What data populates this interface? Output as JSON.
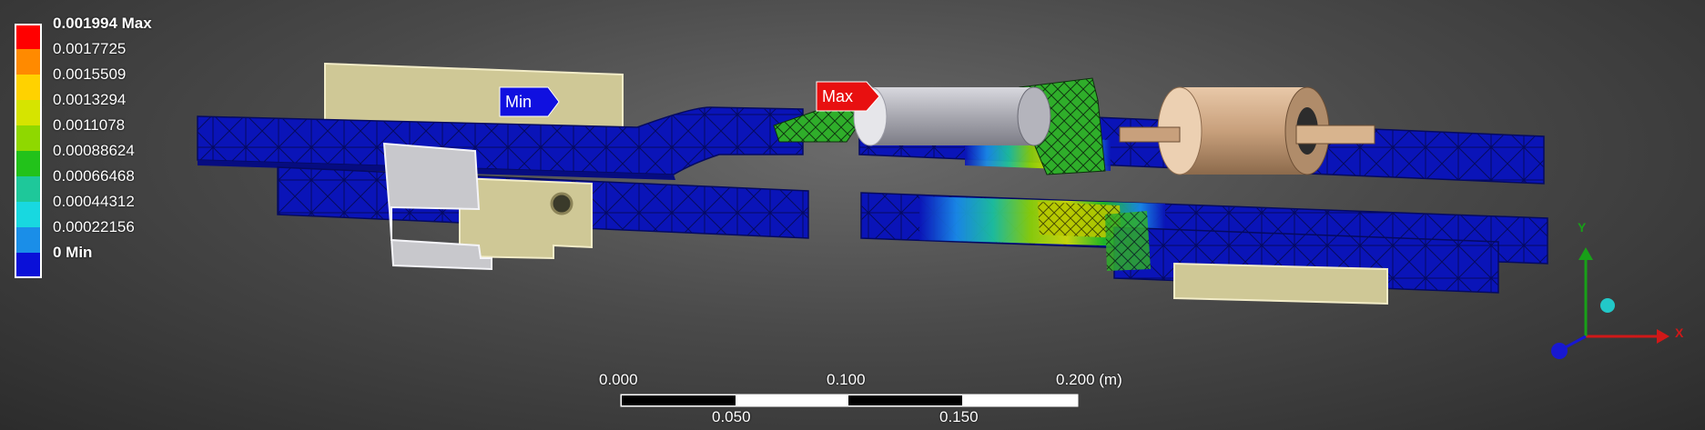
{
  "legend": {
    "entries": [
      {
        "label": "0.001994 Max",
        "color": "#ff0000",
        "bold": true
      },
      {
        "label": "0.0017725",
        "color": "#ff8a00"
      },
      {
        "label": "0.0015509",
        "color": "#ffd200"
      },
      {
        "label": "0.0013294",
        "color": "#d6e400"
      },
      {
        "label": "0.0011078",
        "color": "#8fd800"
      },
      {
        "label": "0.00088624",
        "color": "#22c21a"
      },
      {
        "label": "0.00066468",
        "color": "#1ec89a"
      },
      {
        "label": "0.00044312",
        "color": "#18d8e0"
      },
      {
        "label": "0.00022156",
        "color": "#1a8ee8"
      },
      {
        "label": "0 Min",
        "color": "#0a10d8",
        "bold": true
      }
    ]
  },
  "probes": {
    "min_label": "Min",
    "max_label": "Max",
    "min_color": "#1010e0",
    "max_color": "#e81010"
  },
  "scale_bar": {
    "top_labels": [
      "0.000",
      "0.100",
      "0.200 (m)"
    ],
    "bottom_labels": [
      "0.050",
      "0.150"
    ]
  },
  "triad": {
    "x_label": "X",
    "y_label": "Y",
    "x_color": "#d01818",
    "y_color": "#18a018",
    "z_color": "#1818d0"
  }
}
